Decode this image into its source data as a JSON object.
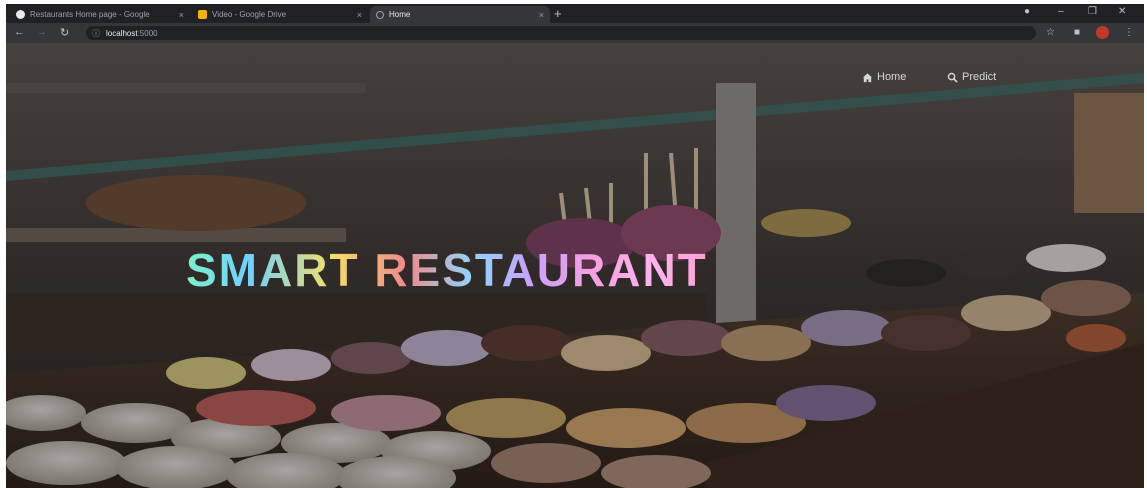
{
  "browser": {
    "tabs": [
      {
        "title": "Restaurants Home page - Google",
        "favicon_color": "#e8eaed",
        "active": false
      },
      {
        "title": "Video - Google Drive",
        "favicon_color": "#f4b400",
        "active": false
      },
      {
        "title": "Home",
        "favicon_color": "#9aa0a6",
        "active": true
      }
    ],
    "new_tab_glyph": "+",
    "close_glyph": "×",
    "address": {
      "host": "localhost",
      "port": ":5000"
    },
    "nav": {
      "back": "←",
      "forward": "→",
      "reload": "↻"
    }
  },
  "page": {
    "nav_items": [
      {
        "label": "Home",
        "icon": "home-icon"
      },
      {
        "label": "Predict",
        "icon": "search-icon"
      }
    ],
    "hero_title": "SMART RESTAURANT",
    "colors": {
      "background_dark": "#2b2420",
      "glass_edge": "#5a8f86",
      "nav_text": "#d6d6d6"
    }
  }
}
